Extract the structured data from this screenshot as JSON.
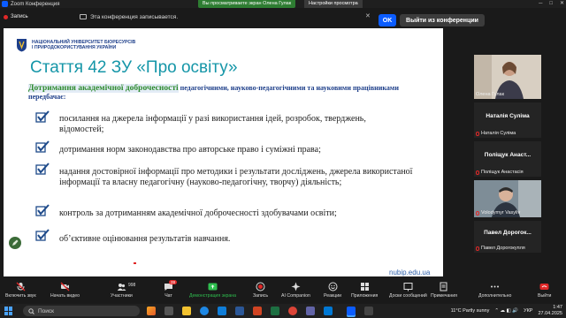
{
  "window": {
    "title": "Zoom Конференция",
    "share_status": "Вы просматриваете экран Олена Гулак",
    "share_settings": "Настройки просмотра"
  },
  "recording": {
    "label": "Запись",
    "notice": "Эта конференция записывается.",
    "ok_label": "OK",
    "leave_label": "Выйти из конференции"
  },
  "slide": {
    "university_line1": "НАЦІОНАЛЬНИЙ УНІВЕРСИТЕТ БІОРЕСУРСІВ",
    "university_line2": "І ПРИРОДОКОРИСТУВАННЯ УКРАЇНИ",
    "title": "Стаття 42 ЗУ «Про освіту»",
    "intro_highlight": "Дотримання академічної доброчесності",
    "intro_rest": "педагогічними, науково-педагогічними та науковими працівниками передбачає:",
    "items": [
      "посилання на джерела інформації у разі використання ідей, розробок, тверджень, відомостей;",
      "дотримання норм законодавства про авторське право і суміжні права;",
      "надання достовірної інформації про методики і результати досліджень, джерела використаної інформації та власну педагогічну (науково-педагогічну, творчу) діяльність;",
      "контроль за дотриманням академічної доброчесності здобувачами освіти;",
      "об’єктивне оцінювання результатів навчання."
    ],
    "url": "nubip.edu.ua"
  },
  "gallery": [
    {
      "display_name": "",
      "label": "Олена Гулак",
      "video": true
    },
    {
      "display_name": "Наталія Суліма",
      "label": "Наталія Суліма",
      "video": false
    },
    {
      "display_name": "Поліщук Анаст...",
      "label": "Поліщук Анастасія",
      "video": false
    },
    {
      "display_name": "",
      "label": "Volodymyr Vasyliv",
      "video": true
    },
    {
      "display_name": "Павел Дорогок...",
      "label": "Павел Дорогокупля",
      "video": false
    }
  ],
  "toolbar": {
    "mic": "Включить звук",
    "video": "Начать видео",
    "participants": "Участники",
    "participants_count": "998",
    "chat": "Чат",
    "chat_badge": "28",
    "share": "Демонстрация экрана",
    "record": "Запись",
    "ai": "AI Companion",
    "reactions": "Реакции",
    "apps": "Приложения",
    "whiteboards": "Доски сообщений",
    "notes": "Примечания",
    "more": "Дополнительно",
    "end": "Выйти"
  },
  "taskbar": {
    "search": "Поиск",
    "weather": "11°C  Partly sunny",
    "lang": "УКР",
    "time": "1:47",
    "date": "27.04.2025"
  },
  "colors": {
    "accent_blue": "#0b5cff",
    "recording_red": "#e02828",
    "share_green": "#2fbf4f",
    "slide_title": "#1596a8"
  }
}
